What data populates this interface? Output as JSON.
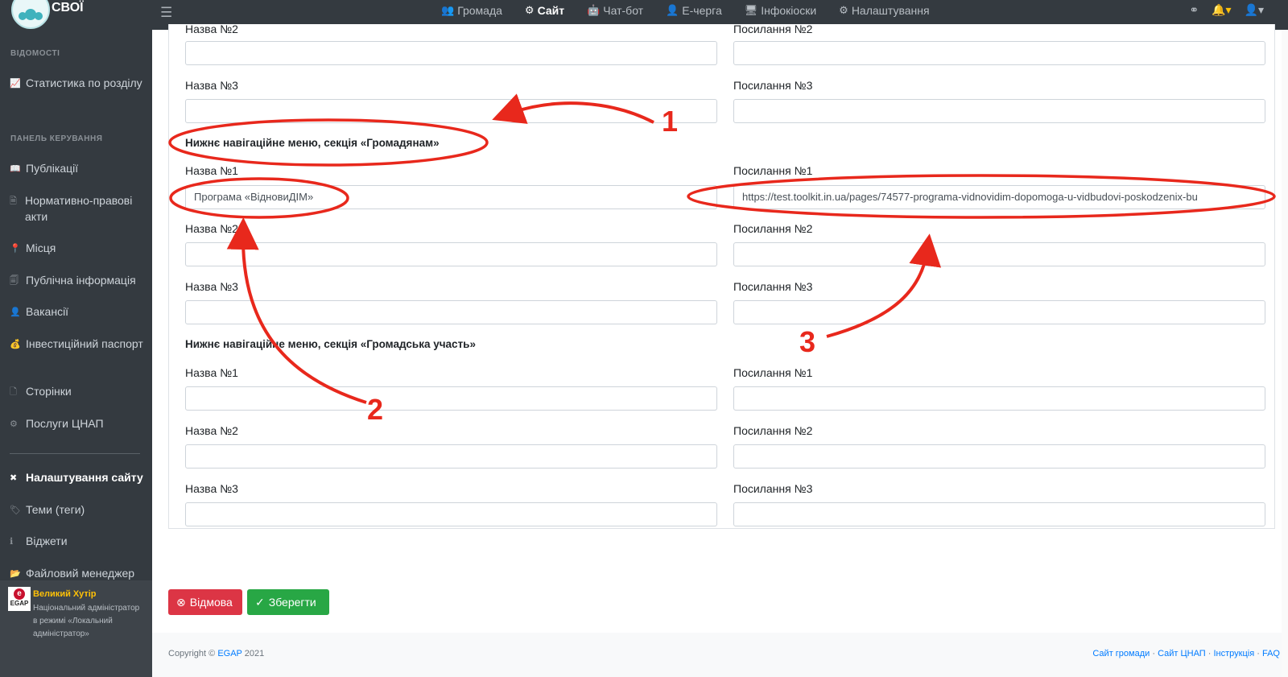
{
  "topbar": {
    "brand": "СВОЇ",
    "nav": [
      {
        "label": "Громада",
        "icon": "users-icon"
      },
      {
        "label": "Сайт",
        "icon": "gear-icon"
      },
      {
        "label": "Чат-бот",
        "icon": "robot-icon"
      },
      {
        "label": "Е-черга",
        "icon": "user-queue-icon"
      },
      {
        "label": "Інфокіоски",
        "icon": "monitor-icon"
      },
      {
        "label": "Налаштування",
        "icon": "cogs-icon"
      }
    ]
  },
  "sidebar": {
    "heading1": "ВІДОМОСТІ",
    "heading2": "ПАНЕЛЬ КЕРУВАННЯ",
    "items": [
      {
        "label": "Статистика по розділу"
      },
      {
        "label": "Публікації"
      },
      {
        "label": "Нормативно-правові акти"
      },
      {
        "label": "Місця"
      },
      {
        "label": "Публічна інформація"
      },
      {
        "label": "Вакансії"
      },
      {
        "label": "Інвестиційний паспорт"
      },
      {
        "label": "Сторінки"
      },
      {
        "label": "Послуги ЦНАП"
      },
      {
        "label": "Налаштування сайту"
      },
      {
        "label": "Теми (теги)"
      },
      {
        "label": "Віджети"
      },
      {
        "label": "Файловий менеджер"
      }
    ],
    "user": {
      "logo": "EGAP",
      "name": "Великий Хутір",
      "role": "Національний адміністратор в режимі «Локальний адміністратор»"
    }
  },
  "form": {
    "top_partial": {
      "name_label": "Назва №2",
      "link_label": "Посилання №2"
    },
    "top_row3": {
      "name_label": "Назва №3",
      "link_label": "Посилання №3"
    },
    "section1": {
      "title": "Нижнє навігаційне меню, секція «Громадянам»",
      "rows": [
        {
          "name_label": "Назва №1",
          "name_value": "Програма «ВідновиДІМ»",
          "link_label": "Посилання №1",
          "link_value": "https://test.toolkit.in.ua/pages/74577-programa-vidnovidim-dopomoga-u-vidbudovi-poskodzenix-bu"
        },
        {
          "name_label": "Назва №2",
          "name_value": "",
          "link_label": "Посилання №2",
          "link_value": ""
        },
        {
          "name_label": "Назва №3",
          "name_value": "",
          "link_label": "Посилання №3",
          "link_value": ""
        }
      ]
    },
    "section2": {
      "title": "Нижнє навігаційне меню, секція «Громадська участь»",
      "rows": [
        {
          "name_label": "Назва №1",
          "link_label": "Посилання №1"
        },
        {
          "name_label": "Назва №2",
          "link_label": "Посилання №2"
        },
        {
          "name_label": "Назва №3",
          "link_label": "Посилання №3"
        }
      ]
    }
  },
  "buttons": {
    "cancel": "Відмова",
    "save": "Зберегти"
  },
  "footer": {
    "copyright_prefix": "Copyright ©",
    "copyright_link": "EGAP",
    "copyright_year": "2021",
    "links": [
      "Сайт громади",
      "Сайт ЦНАП",
      "Інструкція",
      "FAQ"
    ],
    "separator": "·"
  },
  "annotations": {
    "n1": "1",
    "n2": "2",
    "n3": "3",
    "color": "#e8281c"
  }
}
